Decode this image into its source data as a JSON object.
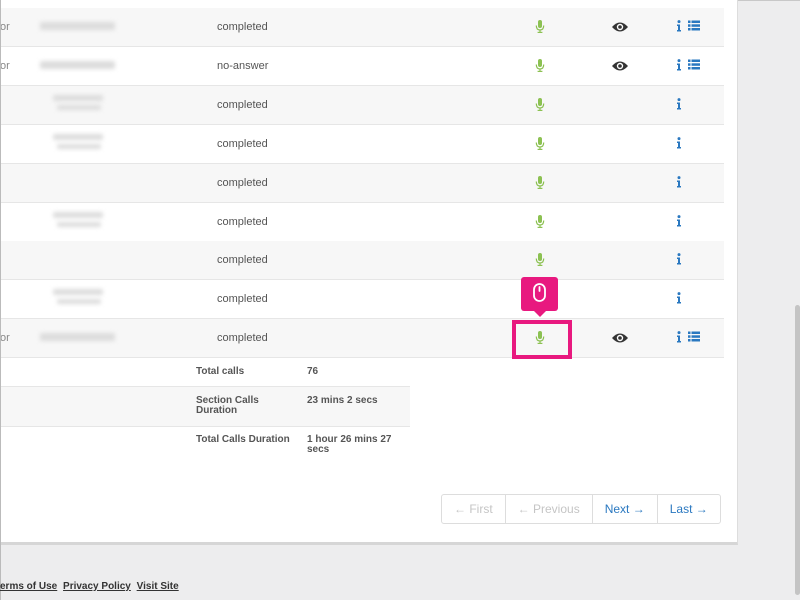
{
  "rows": [
    {
      "prefix": "or",
      "status": "completed",
      "has_eye": true,
      "has_list": true
    },
    {
      "prefix": "or",
      "status": "no-answer",
      "has_eye": true,
      "has_list": true
    },
    {
      "prefix": "",
      "status": "completed",
      "has_eye": false,
      "has_list": false
    },
    {
      "prefix": "",
      "status": "completed",
      "has_eye": false,
      "has_list": false
    },
    {
      "prefix": "",
      "status": "completed",
      "has_eye": false,
      "has_list": false
    },
    {
      "prefix": "",
      "status": "completed",
      "has_eye": false,
      "has_list": false
    },
    {
      "prefix": "",
      "status": "completed",
      "has_eye": false,
      "has_list": false
    },
    {
      "prefix": "",
      "status": "completed",
      "has_eye": false,
      "has_list": false
    },
    {
      "prefix": "or",
      "status": "completed",
      "has_eye": true,
      "has_list": true
    }
  ],
  "summary": {
    "total_calls_label": "Total calls",
    "total_calls_value": "76",
    "section_duration_label": "Section Calls Duration",
    "section_duration_value": "23 mins 2 secs",
    "total_duration_label": "Total Calls Duration",
    "total_duration_value": "1 hour 26 mins 27 secs"
  },
  "pagination": {
    "first": "← First",
    "previous": "← Previous",
    "next": "Next →",
    "last": "Last →"
  },
  "footer": {
    "terms": "erms of Use",
    "privacy": "Privacy Policy",
    "visit": "Visit Site"
  },
  "colors": {
    "mic": "#8cc152",
    "eye": "#333333",
    "info": "#2a78c0",
    "highlight": "#e8197f"
  }
}
